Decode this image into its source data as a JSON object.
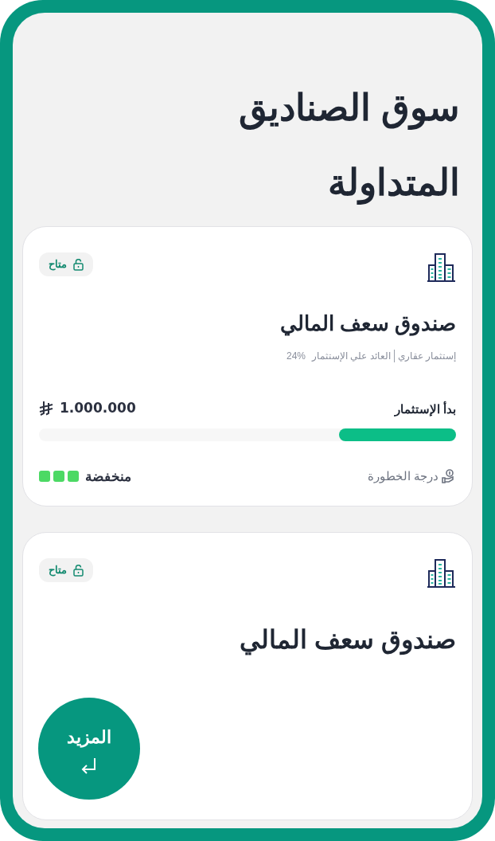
{
  "title": "سوق الصناديق المتداولة",
  "funds": [
    {
      "badge": "متاح",
      "name": "صندوق سعف المالي",
      "subtitle": {
        "category": "إستثمار عقاري",
        "return_label": "العائد علي الإستثمار",
        "return_value": "24%"
      },
      "investment": {
        "label": "بدأ الإستثمار",
        "amount": "1.000.000",
        "level": 0.28
      },
      "risk": {
        "label": "درجة الخطورة",
        "value": "منخفضة",
        "bars": [
          {
            "filled": true
          },
          {
            "filled": true
          },
          {
            "filled": true
          }
        ]
      }
    },
    {
      "badge": "متاح",
      "name": "صندوق سعف المالي"
    }
  ],
  "more_button": {
    "label": "المزيد"
  }
}
